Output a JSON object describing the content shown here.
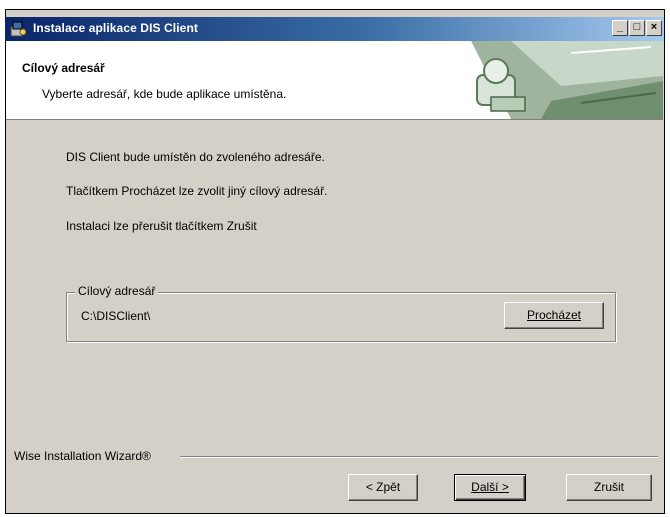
{
  "window": {
    "title": "Instalace aplikace DIS Client",
    "minimize_glyph": "_",
    "maximize_glyph": "□",
    "close_glyph": "×"
  },
  "header": {
    "title": "Cílový adresář",
    "subtitle": "Vyberte adresář, kde bude aplikace umístěna."
  },
  "body": {
    "line1": "DIS Client bude umístěn do zvoleného adresáře.",
    "line2": "Tlačítkem Procházet lze zvolit jiný cílový adresář.",
    "line3": "Instalaci lze přerušit tlačítkem Zrušit"
  },
  "group": {
    "legend": "Cílový adresář",
    "path": "C:\\DISClient\\",
    "browse_label": "Procházet"
  },
  "footer": {
    "brand": "Wise Installation Wizard®",
    "back_label": "< Zpět",
    "next_label": "Další >",
    "cancel_label": "Zrušit"
  },
  "colors": {
    "titlebar_start": "#0a246a",
    "titlebar_end": "#a6caf0",
    "dialog_bg": "#d4d0c8"
  }
}
